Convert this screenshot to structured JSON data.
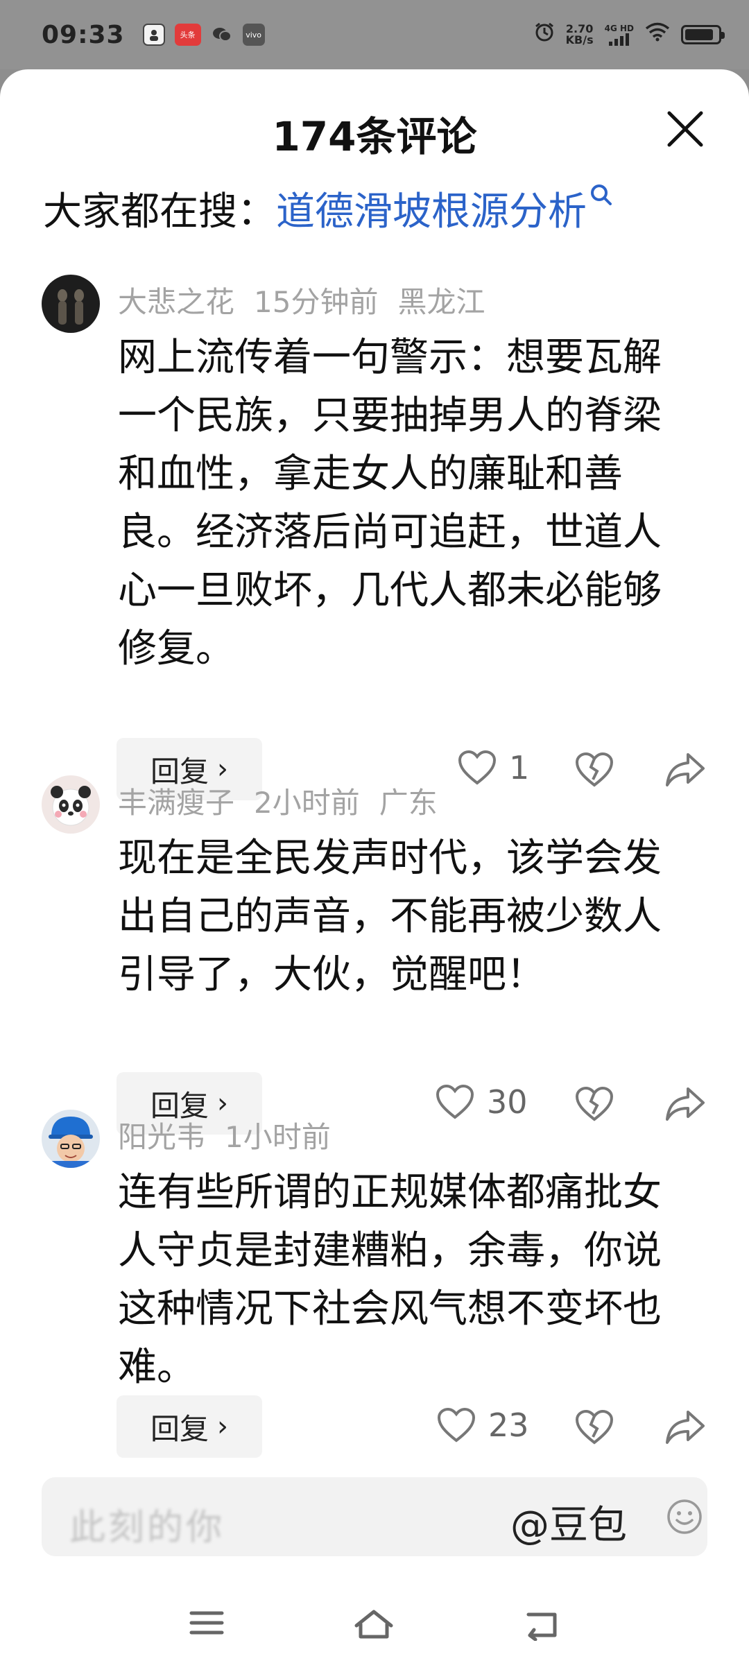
{
  "status_bar": {
    "time": "09:33",
    "net_speed_value": "2.70",
    "net_speed_unit": "KB/s",
    "network": "4G HD",
    "notif_toutiao": "头条",
    "notif_vivo": "vivo"
  },
  "sheet": {
    "title": "174条评论",
    "search_prefix": "大家都在搜：",
    "search_link": "道德滑坡根源分析"
  },
  "comments": [
    {
      "author": "大悲之花",
      "time": "15分钟前",
      "location": "黑龙江",
      "text": "网上流传着一句警示：想要瓦解一个民族，只要抽掉男人的脊梁和血性，拿走女人的廉耻和善良。经济落后尚可追赶，世道人心一旦败坏，几代人都未必能够修复。",
      "reply_label": "回复",
      "likes": "1"
    },
    {
      "author": "丰满瘦子",
      "time": "2小时前",
      "location": "广东",
      "text": "现在是全民发声时代，该学会发出自己的声音，不能再被少数人引导了，大伙，觉醒吧！",
      "reply_label": "回复",
      "likes": "30"
    },
    {
      "author": "阳光韦",
      "time": "1小时前",
      "location": "",
      "text": "连有些所谓的正规媒体都痛批女人守贞是封建糟粕，余毒，你说这种情况下社会风气想不变坏也难。",
      "reply_label": "回复",
      "likes": "23"
    }
  ],
  "input_bar": {
    "placeholder": "此刻的你",
    "mention": "@豆包"
  },
  "icons": {
    "close": "close-icon",
    "search": "search-icon",
    "like": "heart-icon",
    "dislike": "broken-heart-icon",
    "share": "share-icon",
    "emoji": "emoji-icon",
    "menu": "menu-icon",
    "home": "home-icon",
    "back": "back-icon"
  }
}
